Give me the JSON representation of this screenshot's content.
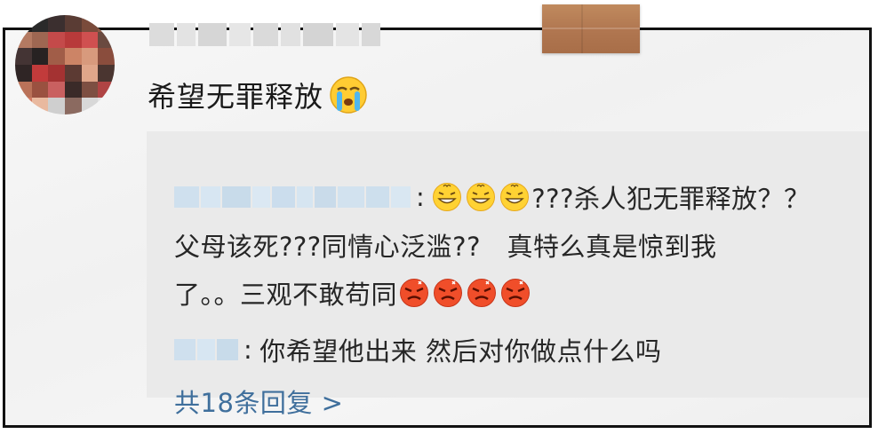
{
  "comment": {
    "text": "希望无罪释放",
    "emoji": "crying-face-icon"
  },
  "replies": [
    {
      "line1": "???杀人犯无罪释放？？",
      "line2": "父母该死???同情心泛滥??　真特么真是惊到我",
      "line3": "了。。三观不敢苟同",
      "emoji_prefix": "grinning-sweat-face-icon",
      "emoji_suffix": "angry-face-icon"
    },
    {
      "text": "你希望他出来 然后对你做点什么吗"
    }
  ],
  "separator": ":",
  "more_replies_label": "共18条回复 >",
  "colors": {
    "link": "#3f6f9c",
    "text": "#1a1a1a",
    "reply_bg": "#e9e9e9",
    "tape": "#b07650"
  }
}
